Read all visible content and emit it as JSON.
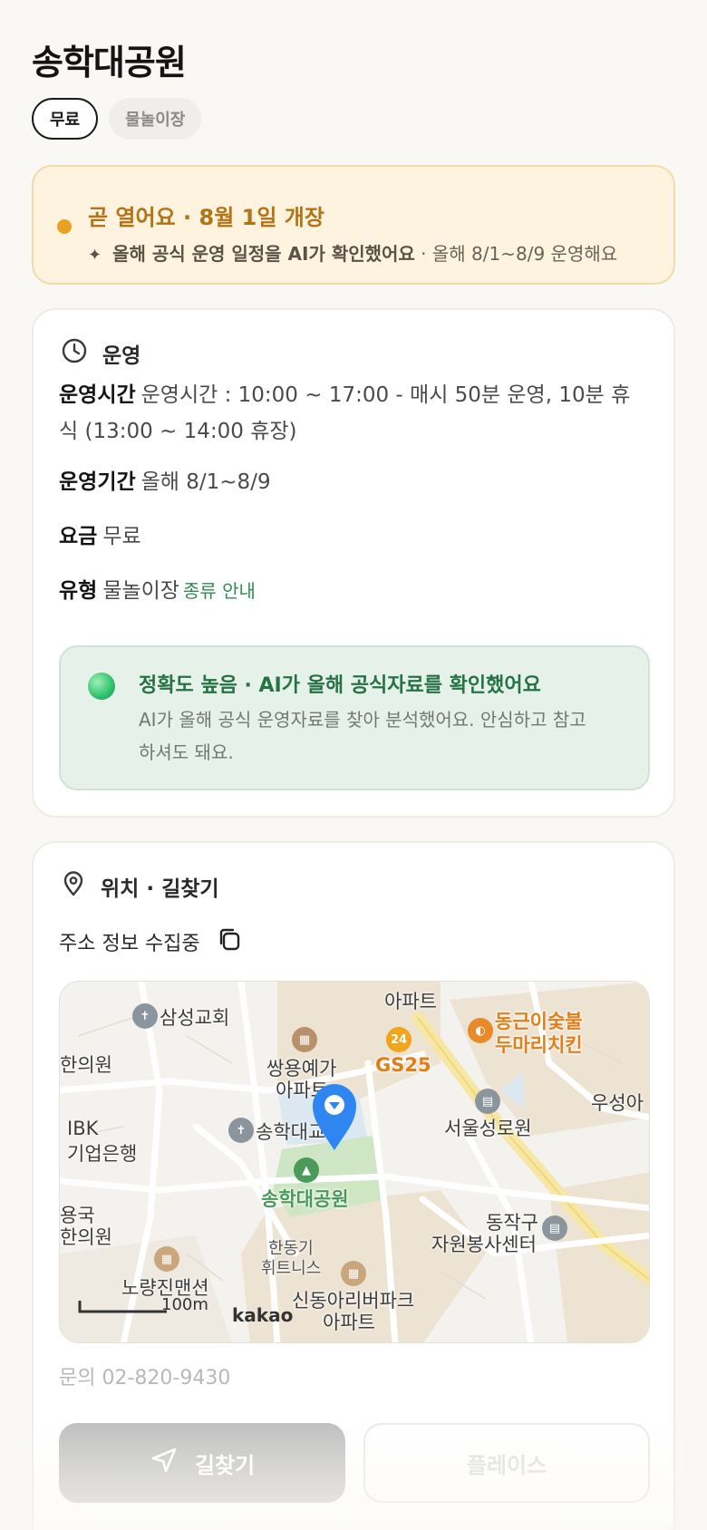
{
  "title": "송학대공원",
  "chips": [
    {
      "label": "무료"
    },
    {
      "label": "물놀이장"
    }
  ],
  "notice": {
    "headline": "곧 열어요 · 8월 1일 개장",
    "sparkle": "✦",
    "bold": "올해 공식 운영 일정을 AI가 확인했어요",
    "rest": " · 올해 8/1~8/9 운영해요"
  },
  "operation": {
    "section_title": "운영",
    "rows": {
      "hours": {
        "label": "운영시간",
        "value": "운영시간 : 10:00 ~ 17:00 - 매시 50분 운영, 10분 휴식 (13:00 ~ 14:00 휴장)"
      },
      "period": {
        "label": "운영기간",
        "value": "올해 8/1~8/9"
      },
      "fee": {
        "label": "요금",
        "value": "무료"
      },
      "type": {
        "label": "유형",
        "value": "물놀이장",
        "link": "종류 안내"
      }
    },
    "accuracy": {
      "headline": "정확도 높음 · AI가 올해 공식자료를 확인했어요",
      "body": "AI가 올해 공식 운영자료를 찾아 분석했어요. 안심하고 참고하셔도 돼요."
    }
  },
  "location": {
    "section_title": "위치 · 길찾기",
    "address": "주소 정보 수집중",
    "map": {
      "labels": {
        "samsung_church": "삼성교회",
        "apartment_top": "아파트",
        "donggeun": "동근이숯불",
        "dumari": "두마리치킨",
        "clinic": "한의원",
        "ssangyong_1": "쌍용예가",
        "ssangyong_2": "아파트",
        "gs25": "GS25",
        "usung": "우성아",
        "ibk_1": "IBK",
        "ibk_2": "기업은행",
        "songhak_church": "송학대교회",
        "seoul_hospital": "서울성로원",
        "park": "송학대공원",
        "yongguk_1": "용국",
        "yongguk_2": "한의원",
        "dongjak_1": "동작구",
        "dongjak_2": "자원봉사센터",
        "handong_1": "한동기",
        "handong_2": "휘트니스",
        "noryangjin": "노량진맨션",
        "sindong": "신동아리버파크",
        "sindong_2": "아파트",
        "scale": "100m",
        "brand": "kakao",
        "gs_badge": "24"
      }
    },
    "phone": "문의 02-820-9430",
    "find_button": "길찾기",
    "place_button": "플레이스"
  }
}
